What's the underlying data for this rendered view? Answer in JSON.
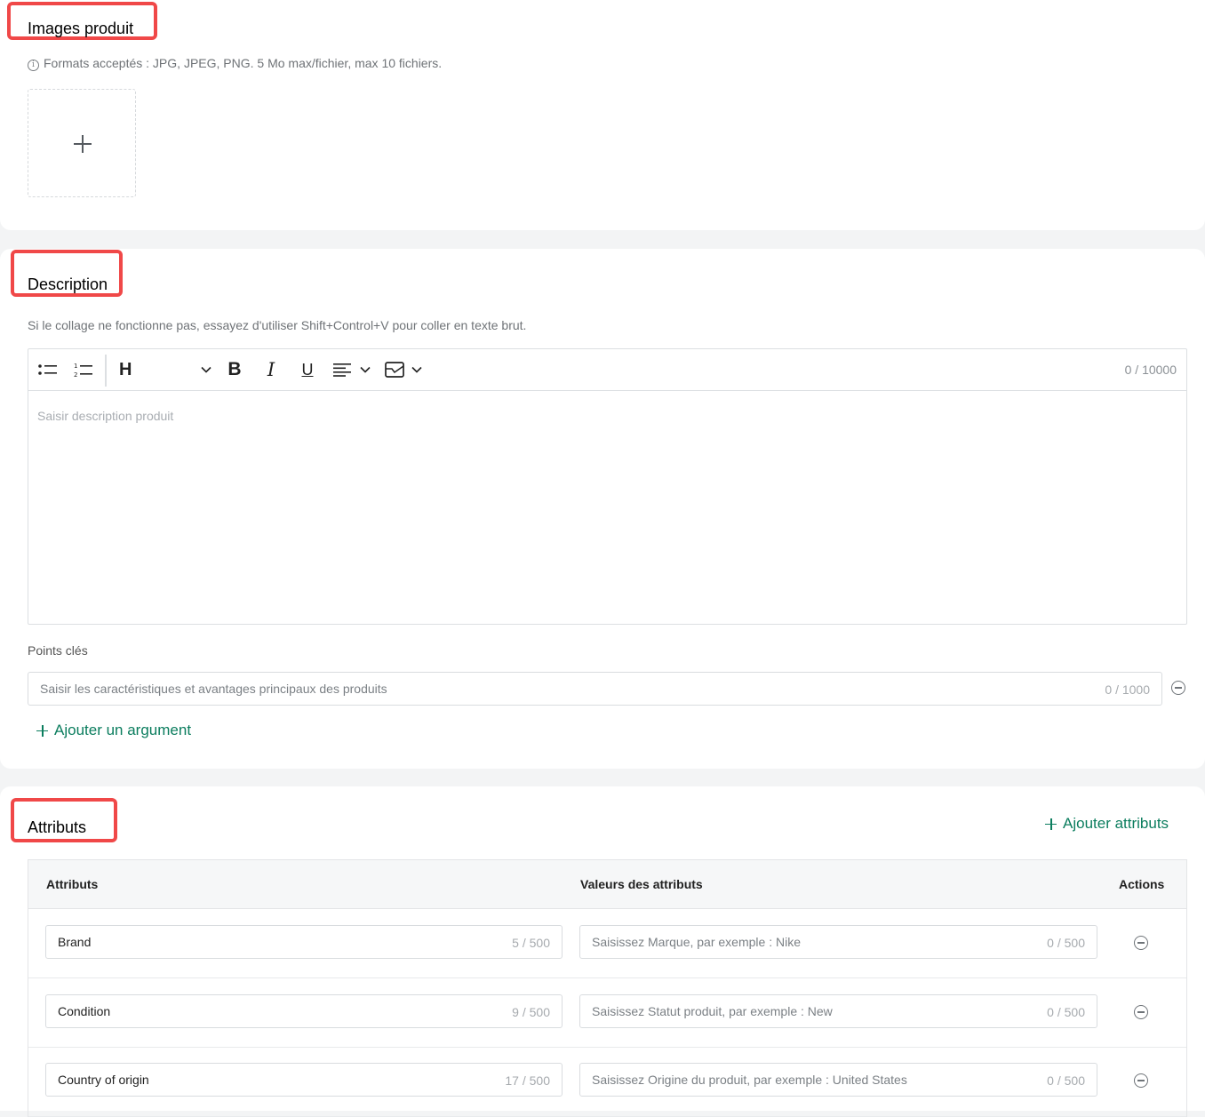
{
  "images_section": {
    "title": "Images produit",
    "hint": "Formats acceptés : JPG, JPEG, PNG. 5 Mo max/fichier, max 10 fichiers."
  },
  "description_section": {
    "title": "Description",
    "hint": "Si le collage ne fonctionne pas, essayez d'utiliser Shift+Control+V pour coller en texte brut.",
    "toolbar": {
      "heading_label": "H",
      "bold_label": "B",
      "italic_label": "I",
      "underline_label": "U",
      "char_counter": "0 / 10000"
    },
    "editor_placeholder": "Saisir description produit",
    "key_points": {
      "label": "Points clés",
      "placeholder": "Saisir les caractéristiques et avantages principaux des produits",
      "counter": "0 / 1000",
      "add_label": "Ajouter un argument"
    }
  },
  "attributes_section": {
    "title": "Attributs",
    "add_label": "Ajouter attributs",
    "columns": [
      "Attributs",
      "Valeurs des attributs",
      "Actions"
    ],
    "rows": [
      {
        "name": "Brand",
        "name_count": "5 / 500",
        "value_placeholder": "Saisissez Marque, par exemple : Nike",
        "value_count": "0 / 500"
      },
      {
        "name": "Condition",
        "name_count": "9 / 500",
        "value_placeholder": "Saisissez Statut produit, par exemple : New",
        "value_count": "0 / 500"
      },
      {
        "name": "Country of origin",
        "name_count": "17 / 500",
        "value_placeholder": "Saisissez Origine du produit, par exemple : United States",
        "value_count": "0 / 500"
      }
    ]
  },
  "colors": {
    "accent_green": "#0b7d5e",
    "highlight_red": "#f04848"
  }
}
